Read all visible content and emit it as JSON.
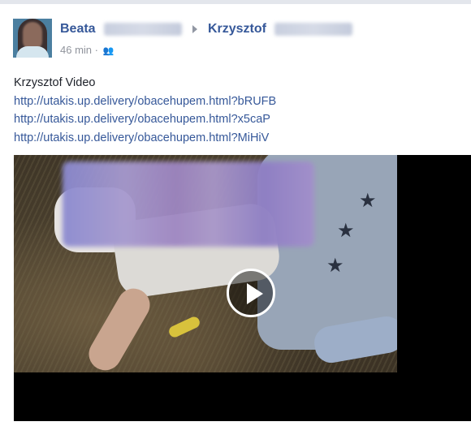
{
  "post": {
    "author": "Beata",
    "recipient": "Krzysztof",
    "timestamp": "46 min",
    "audience_icon": "group-icon",
    "message": "Krzysztof Video",
    "links": [
      "http://utakis.up.delivery/obacehupem.html?bRUFB",
      "http://utakis.up.delivery/obacehupem.html?x5caP",
      "http://utakis.up.delivery/obacehupem.html?MiHiV"
    ],
    "video": {
      "play_icon": "play-icon"
    }
  },
  "colors": {
    "link": "#365899",
    "text": "#1d2129",
    "meta": "#90949c"
  }
}
